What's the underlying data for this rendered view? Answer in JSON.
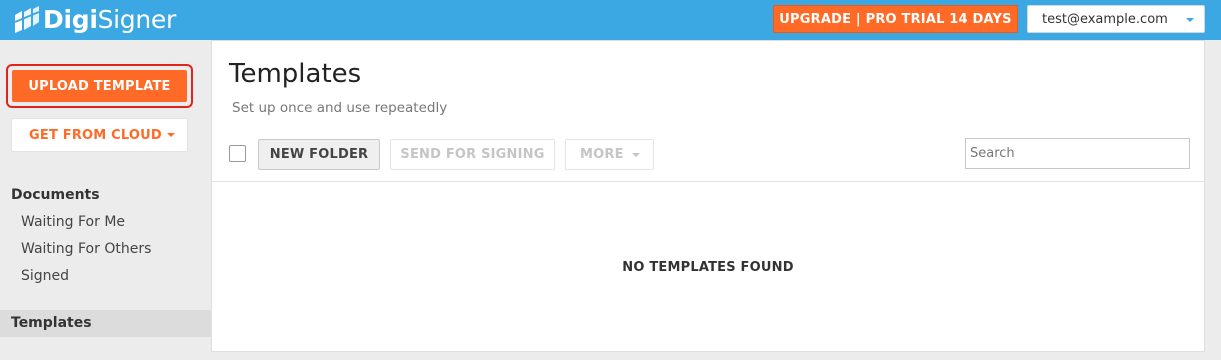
{
  "app": {
    "logo_text_bold": "Digi",
    "logo_text_regular": "Signer",
    "logo_icon": "digisigner-logo-icon"
  },
  "header": {
    "upgrade_label": "UPGRADE | PRO TRIAL 14 DAYS",
    "user_email": "test@example.com"
  },
  "sidebar": {
    "upload_label": "UPLOAD TEMPLATE",
    "cloud_label": "GET FROM CLOUD",
    "documents_heading": "Documents",
    "document_items": [
      {
        "label": "Waiting For Me"
      },
      {
        "label": "Waiting For Others"
      },
      {
        "label": "Signed"
      }
    ],
    "templates_label": "Templates",
    "active_item": "Templates"
  },
  "main": {
    "title": "Templates",
    "subtitle": "Set up once and use repeatedly",
    "toolbar": {
      "new_folder_label": "NEW FOLDER",
      "send_for_signing_label": "SEND FOR SIGNING",
      "more_label": "MORE"
    },
    "search": {
      "placeholder": "Search",
      "value": ""
    },
    "empty_message": "NO TEMPLATES FOUND"
  },
  "colors": {
    "topbar": "#3ba7e3",
    "accent": "#ff6a26",
    "highlight_outline": "#e0231c",
    "sidebar_bg": "#ececec",
    "active_item_bg": "#dcdcdc"
  }
}
